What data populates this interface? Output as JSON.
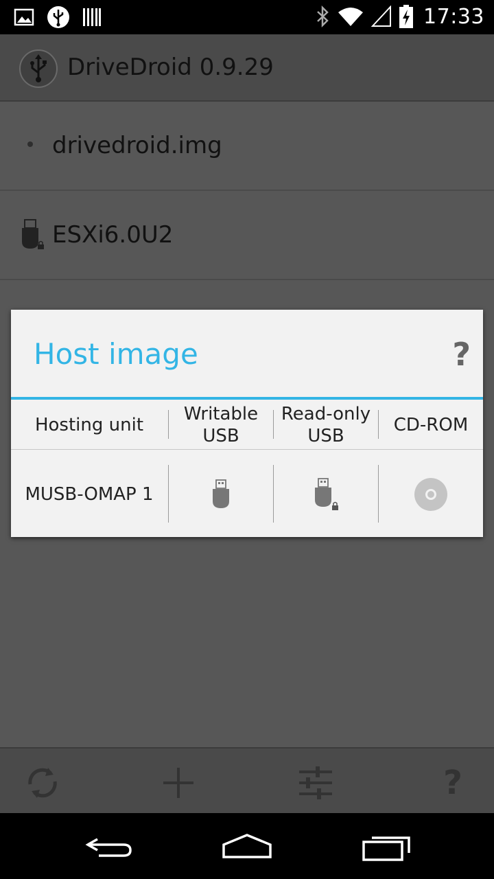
{
  "status_bar": {
    "time": "17:33",
    "left_icons": [
      "image-notification-icon",
      "usb-notification-icon",
      "barcode-notification-icon"
    ],
    "right_icons": [
      "bluetooth-icon",
      "wifi-icon",
      "signal-icon",
      "battery-charging-icon"
    ]
  },
  "action_bar": {
    "title": "DriveDroid 0.9.29",
    "icon": "usb-app-icon"
  },
  "list": {
    "items": [
      {
        "label": "drivedroid.img",
        "icon": "bullet"
      },
      {
        "label": "ESXi6.0U2",
        "icon": "usb-locked-icon"
      }
    ]
  },
  "dialog": {
    "title": "Host image",
    "help": "?",
    "accent_color": "#33b5e5",
    "headers": {
      "unit": "Hosting unit",
      "writable_1": "Writable",
      "writable_2": "USB",
      "readonly_1": "Read-only",
      "readonly_2": "USB",
      "cdrom": "CD-ROM"
    },
    "rows": [
      {
        "unit": "MUSB-OMAP 1",
        "writable_icon": "usb-icon",
        "readonly_icon": "usb-locked-icon",
        "cdrom_icon": "cd-icon"
      }
    ]
  },
  "bottom_bar": {
    "items": [
      "refresh-icon",
      "add-icon",
      "settings-sliders-icon",
      "help-icon"
    ],
    "help_glyph": "?"
  },
  "nav_bar": {
    "items": [
      "back-icon",
      "home-icon",
      "recents-icon"
    ]
  }
}
